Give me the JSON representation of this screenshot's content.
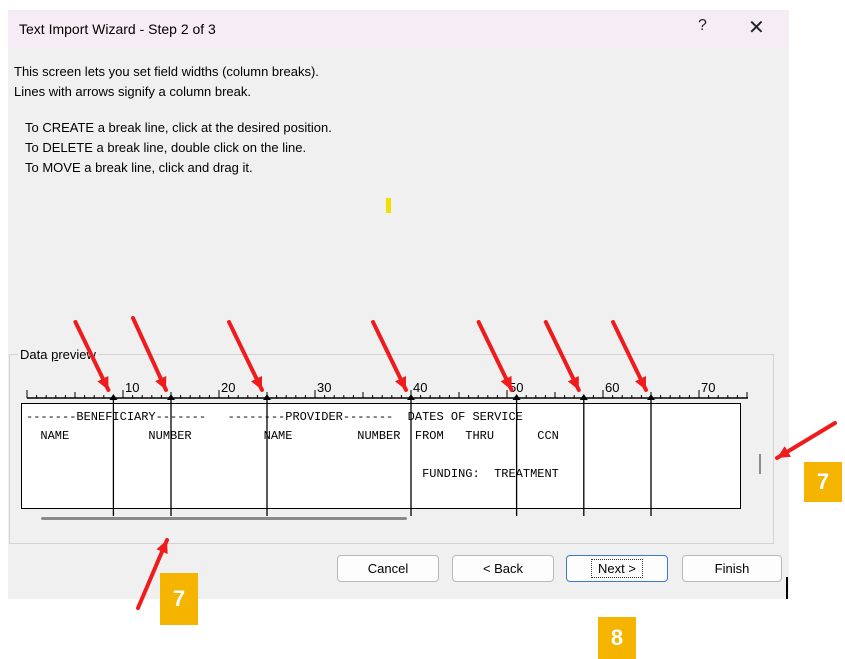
{
  "dialog": {
    "title": "Text Import Wizard - Step 2 of 3",
    "help_glyph": "?",
    "close_glyph": "✕"
  },
  "instructions": {
    "line1": "This screen lets you set field widths (column breaks).",
    "line2": "Lines with arrows signify a column break.",
    "create": "To CREATE a break line, click at the desired position.",
    "delete": "To DELETE a break line, double click on the line.",
    "move": "To MOVE a break line, click and drag it."
  },
  "preview": {
    "label": "Data preview",
    "label_access_key": "p",
    "ruler_ticks": [
      "10",
      "20",
      "30",
      "40",
      "50",
      "60",
      "70"
    ],
    "column_breaks": [
      9,
      15,
      25,
      40,
      51,
      58,
      65
    ],
    "rows": [
      "-------BENEFICIARY-------   --------PROVIDER-------  DATES OF SERVICE",
      "  NAME           NUMBER          NAME         NUMBER  FROM   THRU      CCN",
      "",
      "                                                       FUNDING:  TREATMENT"
    ]
  },
  "buttons": {
    "cancel": "Cancel",
    "back": "< Back",
    "next": "Next >",
    "finish": "Finish"
  },
  "annotations": {
    "badge_7_right": "7",
    "badge_7_bottom": "7",
    "badge_8": "8",
    "arrow_color": "#ee1c1c",
    "badge_color": "#f5b400",
    "accent_color": "#3c78d8"
  }
}
